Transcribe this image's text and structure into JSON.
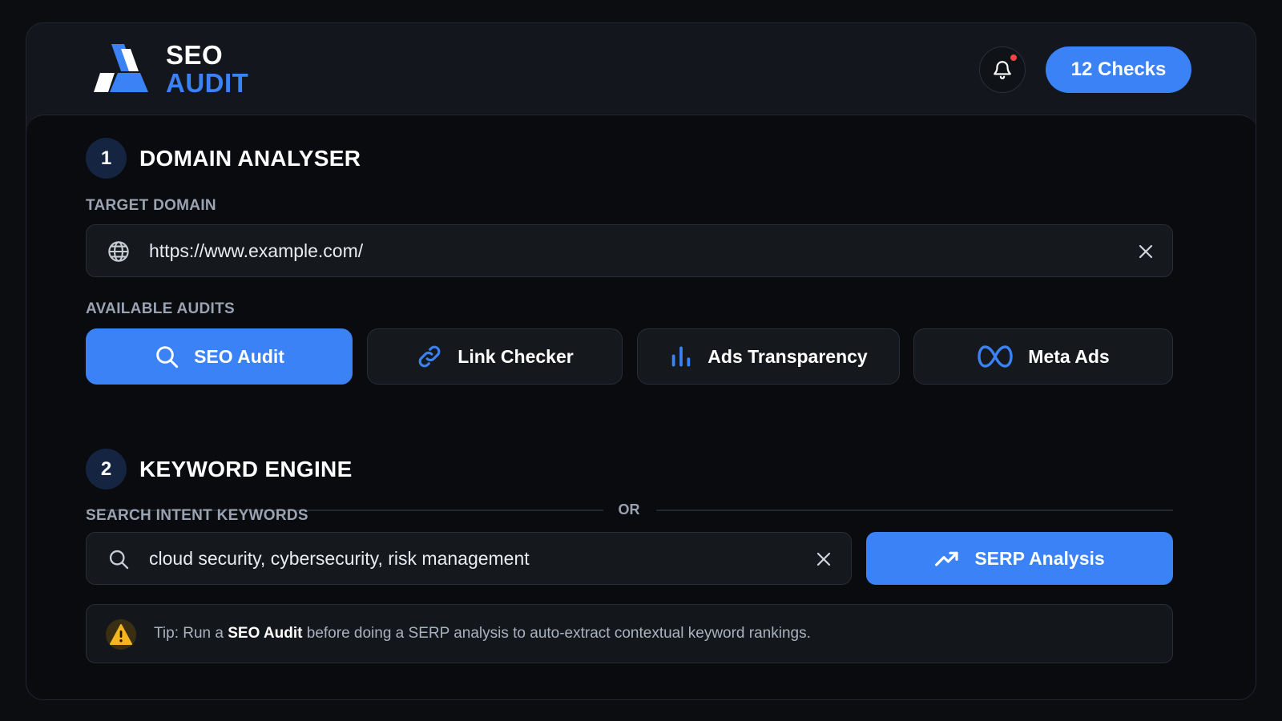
{
  "header": {
    "logo_line1": "SEO",
    "logo_line2": "AUDIT",
    "checks_label": "12 Checks"
  },
  "section1": {
    "number": "1",
    "title": "DOMAIN ANALYSER",
    "domain_label": "TARGET DOMAIN",
    "domain_value": "https://www.example.com/",
    "audits_label": "AVAILABLE AUDITS",
    "audits": [
      {
        "label": "SEO Audit",
        "icon": "search-icon",
        "active": true
      },
      {
        "label": "Link Checker",
        "icon": "link-icon",
        "active": false
      },
      {
        "label": "Ads Transparency",
        "icon": "bar-chart-icon",
        "active": false
      },
      {
        "label": "Meta Ads",
        "icon": "meta-icon",
        "active": false
      }
    ]
  },
  "divider": {
    "label": "OR"
  },
  "section2": {
    "number": "2",
    "title": "KEYWORD ENGINE",
    "keywords_label": "SEARCH INTENT KEYWORDS",
    "keywords_value": "cloud security, cybersecurity, risk management",
    "serp_label": "SERP Analysis"
  },
  "tip": {
    "prefix": "Tip: Run a ",
    "highlight": "SEO Audit",
    "suffix": " before doing a SERP analysis to auto-extract contextual keyword rankings."
  },
  "colors": {
    "accent": "#3b82f6",
    "notification_dot": "#ef4444",
    "warning": "#f5b51f"
  }
}
